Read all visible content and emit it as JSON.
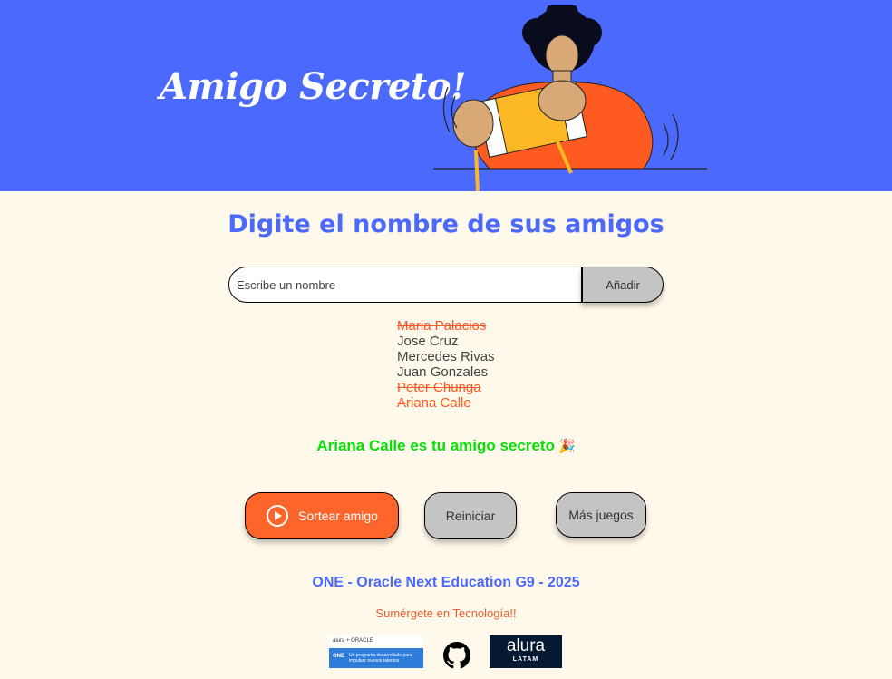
{
  "header": {
    "title": "Amigo Secreto!"
  },
  "main": {
    "title": "Digite el nombre de sus amigos",
    "input": {
      "placeholder": "Escribe un nombre",
      "value": ""
    },
    "add_label": "Añadir",
    "friends": [
      {
        "name": "Maria Palacios",
        "drawn": true
      },
      {
        "name": "Jose Cruz",
        "drawn": false
      },
      {
        "name": "Mercedes Rivas",
        "drawn": false
      },
      {
        "name": "Juan Gonzales",
        "drawn": false
      },
      {
        "name": "Peter Chunga",
        "drawn": true
      },
      {
        "name": "Ariana Calle",
        "drawn": true
      }
    ],
    "result": "Ariana Calle es tu amigo secreto",
    "result_emoji": "🎉"
  },
  "actions": {
    "draw_label": "Sortear amigo",
    "reset_label": "Reiniciar",
    "more_games_label": "Más juegos"
  },
  "footer": {
    "title": "ONE - Oracle Next Education G9 - 2025",
    "subtitle": "Sumérgete en Tecnología!!",
    "one_logo": {
      "top": "alura + ORACLE",
      "brand": "ONE",
      "tagline": "Un programa desarrollado para impulsar nuevos talentos"
    },
    "github_icon": "github-icon",
    "alura_logo": {
      "name": "alura",
      "region": "LATAM"
    }
  },
  "colors": {
    "hero": "#4B69FD",
    "background": "#FFF9EB",
    "accent": "#FE652B",
    "result": "#05DF05",
    "button_gray": "#C4C4C4"
  }
}
